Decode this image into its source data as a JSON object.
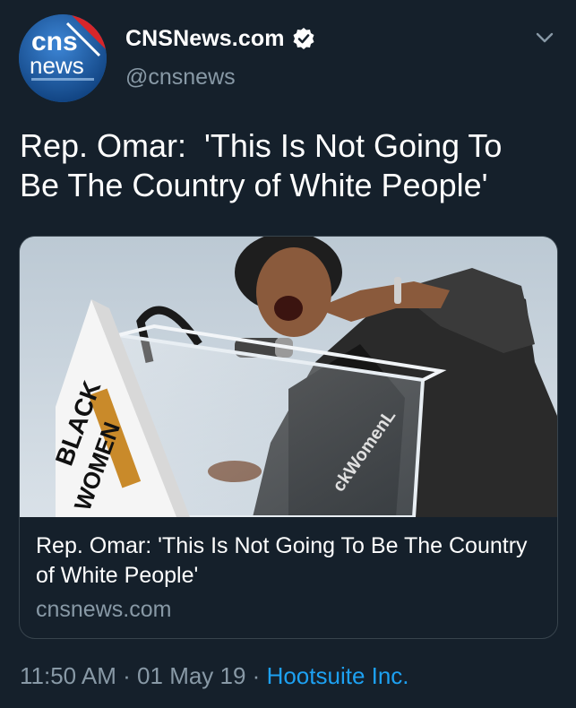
{
  "colors": {
    "background": "#15202b",
    "text_primary": "#ffffff",
    "text_secondary": "#8899a6",
    "link": "#1da1f2",
    "card_border": "#38444d",
    "verified_badge": "#ffffff"
  },
  "author": {
    "display_name": "CNSNews.com",
    "handle": "@cnsnews",
    "verified": true,
    "avatar": {
      "logo_top": "cns",
      "logo_bottom": "news"
    },
    "menu_icon": "chevron-down-icon"
  },
  "tweet": {
    "text": "Rep. Omar:  'This Is Not Going To\nBe The Country of White People'"
  },
  "card": {
    "image_alt": "photo",
    "sign_text_top": "BLACK",
    "sign_text_bottom": "WOMEN",
    "shirt_text": "ckWomenL",
    "title": "Rep. Omar: 'This Is Not Going To Be The Country of White People'",
    "domain": "cnsnews.com"
  },
  "footer": {
    "time": "11:50 AM",
    "separator": " · ",
    "date": "01 May 19",
    "source": "Hootsuite Inc."
  }
}
